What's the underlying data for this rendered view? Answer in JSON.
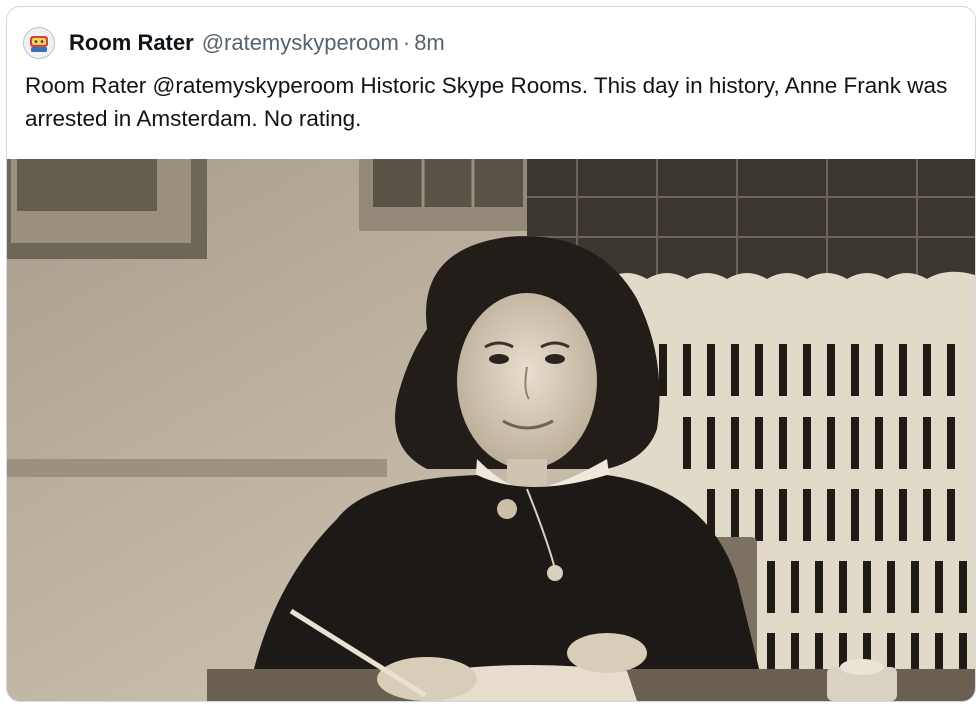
{
  "tweet": {
    "author_name": "Room Rater",
    "author_handle": "@ratemyskyperoom",
    "separator": "·",
    "timestamp": "8m",
    "text": "Room Rater @ratemyskyperoom Historic Skype Rooms. This day in history, Anne Frank was arrested in Amsterdam. No rating."
  },
  "icons": {
    "avatar": "room-rater-logo-avatar"
  },
  "colors": {
    "border": "#cfd9de",
    "name": "#0f1419",
    "secondary_text": "#536471",
    "photo_tone": "#c4b9a6"
  }
}
